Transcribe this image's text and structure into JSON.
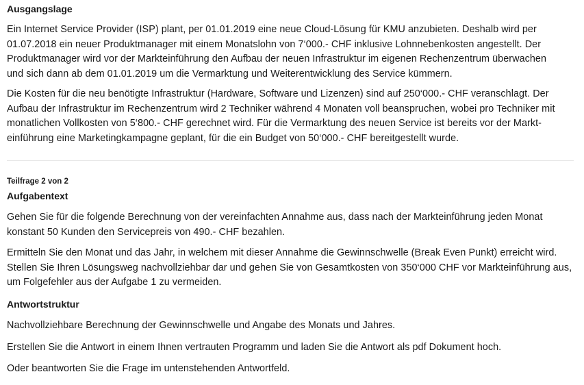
{
  "ausgangslage": {
    "title": "Ausgangslage",
    "p1": [
      "Ein Internet Service Provider (ISP) plant, per 01.01.2019 eine neue Cloud-Lösung für KMU anzubieten. Deshalb wird per",
      "01.07.2018 ein neuer Produktmanager mit einem Monatslohn von 7‘000.- CHF inklusive Lohnnebenkosten angestellt. Der",
      "Produktmanager wird vor der Markteinführung den Aufbau der neuen Infrastruktur im eigenen Rechenzentrum überwachen",
      "und sich dann ab dem 01.01.2019 um die Vermarktung und Weiterentwicklung des Service kümmern."
    ],
    "p2": [
      "Die Kosten für die neu benötigte Infrastruktur (Hardware, Software und Lizenzen) sind auf 250‘000.- CHF veranschlagt. Der",
      "Aufbau der Infrastruktur im Rechenzentrum wird 2 Techniker während 4 Monaten voll beanspruchen, wobei pro Techniker mit",
      "monatlichen Vollkosten von 5‘800.- CHF gerechnet wird. Für die Vermarktung des neuen Service ist bereits vor der Markt-",
      "einführung eine Marketingkampagne geplant, für die ein Budget von 50‘000.- CHF bereitgestellt wurde."
    ]
  },
  "teilfrage": {
    "label": "Teilfrage 2 von 2",
    "title": "Aufgabentext",
    "p1": [
      "Gehen Sie für die folgende Berechnung von der vereinfachten Annahme aus, dass nach der Markteinführung jeden Monat",
      "konstant 50 Kunden den Servicepreis von 490.- CHF bezahlen."
    ],
    "p2": [
      "Ermitteln Sie den Monat und das Jahr, in welchem mit dieser Annahme die Gewinnschwelle (Break Even Punkt) erreicht wird.",
      "Stellen Sie Ihren Lösungsweg nachvollziehbar dar und gehen Sie von Gesamtkosten von 350‘000 CHF vor Markteinführung aus,",
      "um Folgefehler aus der Aufgabe 1 zu vermeiden."
    ]
  },
  "antwortstruktur": {
    "title": "Antwortstruktur",
    "p1": "Nachvollziehbare Berechnung der Gewinnschwelle und Angabe des Monats und Jahres.",
    "p2": "Erstellen Sie die Antwort in einem Ihnen vertrauten Programm und laden Sie die Antwort als pdf Dokument hoch.",
    "p3": "Oder beantworten Sie die Frage im untenstehenden Antwortfeld."
  }
}
